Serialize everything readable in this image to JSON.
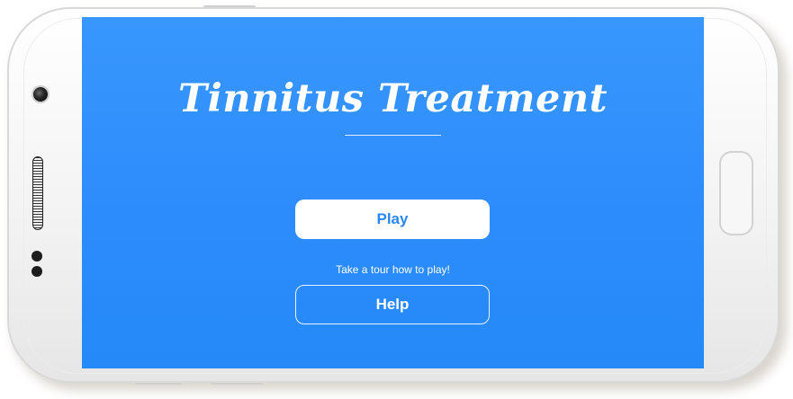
{
  "app": {
    "title": "Tinnitus Treatment"
  },
  "main": {
    "play_label": "Play",
    "tour_text": "Take a tour how to play!",
    "help_label": "Help"
  },
  "colors": {
    "screen_background": "#2d8cfb",
    "primary_button_background": "#ffffff",
    "primary_button_text": "#2a87f0",
    "secondary_button_border": "#ffffff",
    "text": "#ffffff",
    "device_body": "#f3f3f3"
  },
  "icons": {
    "device_frame": "smartphone-frame",
    "front_camera": "camera-icon",
    "speaker": "speaker-grille-icon",
    "home": "home-button"
  }
}
